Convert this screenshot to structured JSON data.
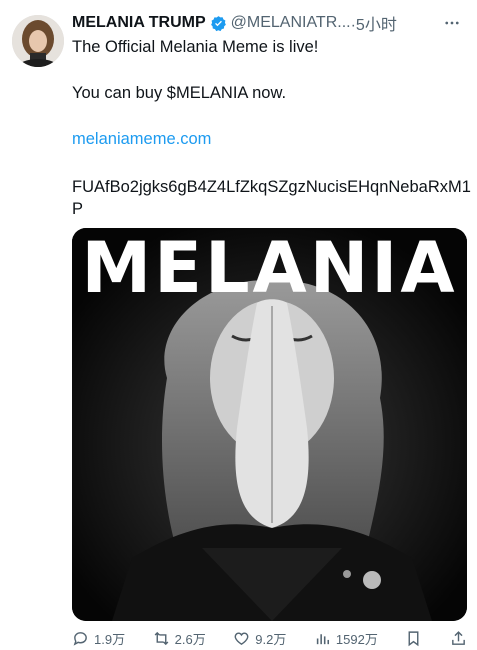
{
  "author": {
    "name": "MELANIA TRUMP",
    "handle": "@MELANIATR...",
    "time": "·5小时"
  },
  "tweet": {
    "line1": "The Official Melania Meme is live!",
    "line2": "You can buy $MELANIA now.",
    "link": "melaniameme.com",
    "address": "FUAfBo2jgks6gB4Z4LfZkqSZgzNucisEHqnNebaRxM1P"
  },
  "media": {
    "title": "MELANIA"
  },
  "actions": {
    "replies": "1.9万",
    "retweets": "2.6万",
    "likes": "9.2万",
    "views": "1592万"
  },
  "icons": {
    "verified": "verified-badge-icon",
    "more": "more-icon",
    "reply": "reply-icon",
    "retweet": "retweet-icon",
    "like": "heart-icon",
    "views": "views-icon",
    "bookmark": "bookmark-icon",
    "share": "share-icon"
  },
  "colors": {
    "link": "#1d9bf0",
    "secondary": "#536471",
    "text": "#0f1419"
  }
}
